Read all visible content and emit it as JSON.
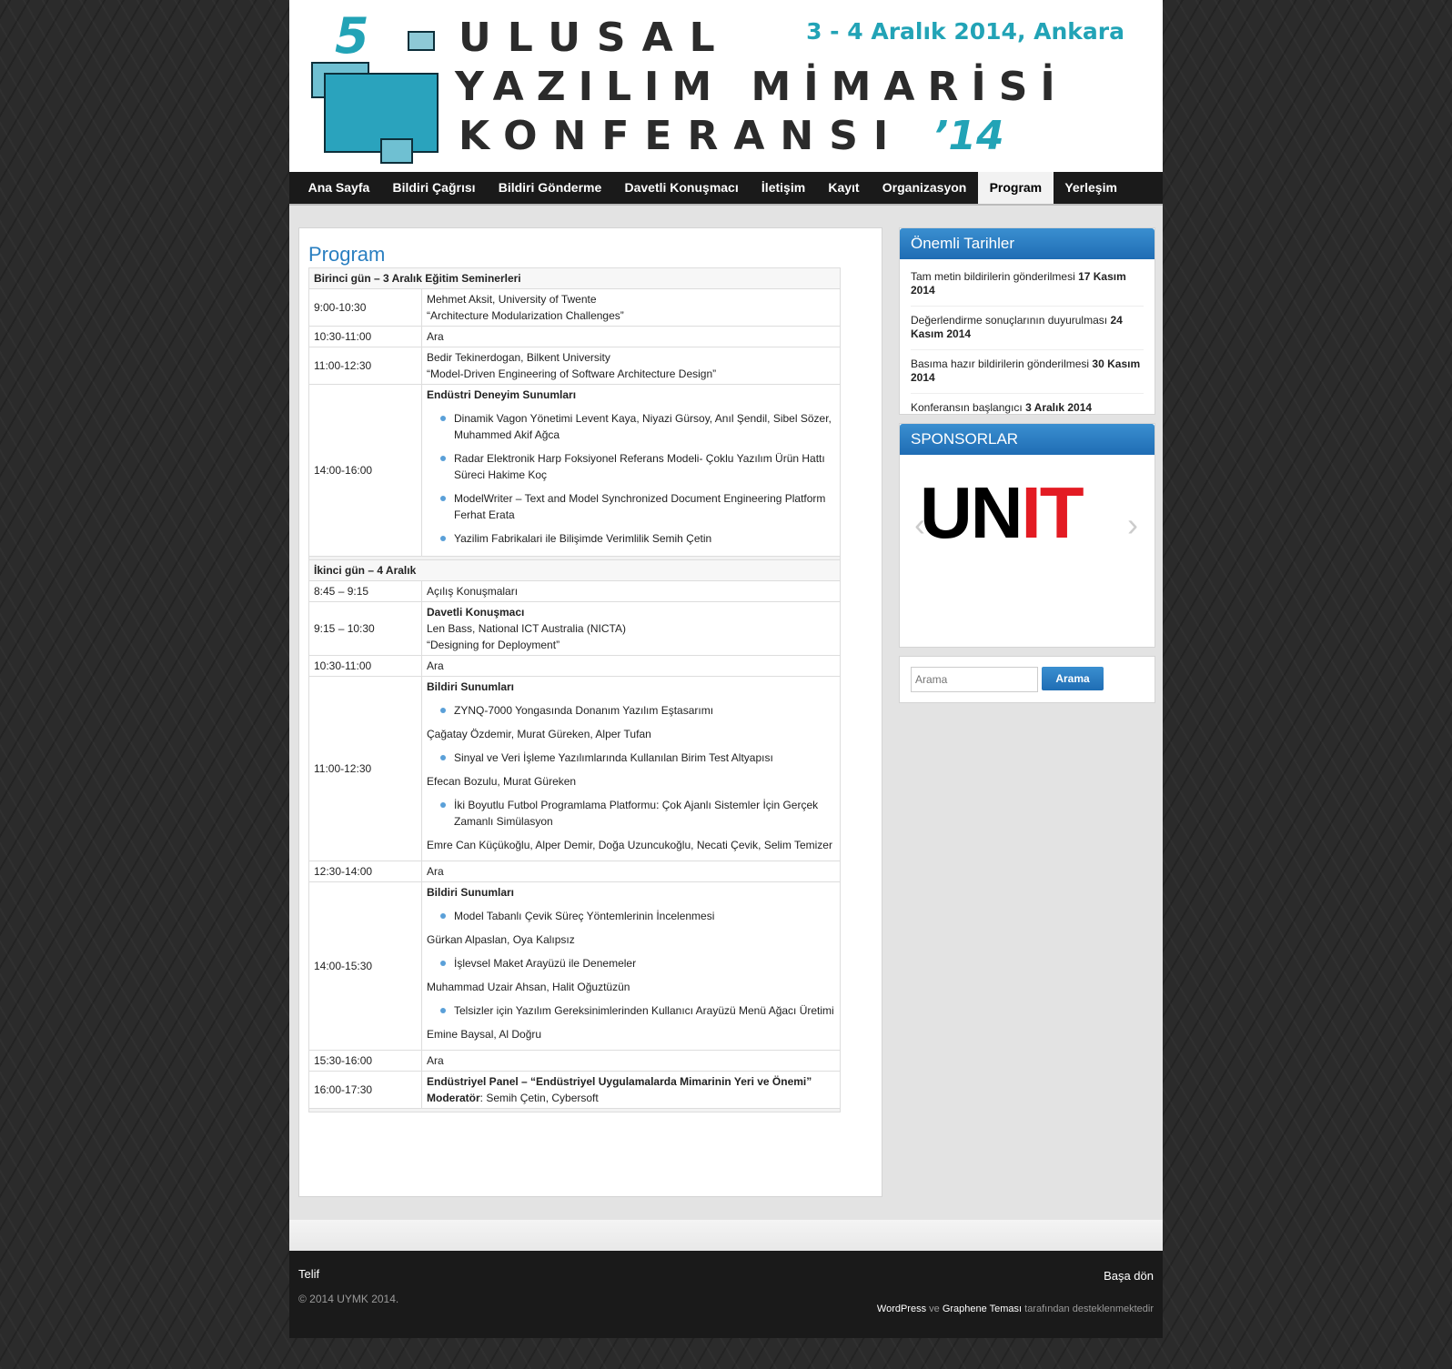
{
  "header": {
    "number": "5",
    "line1": "ULUSAL",
    "line2": "YAZILIM MİMARİSİ",
    "line3": "KONFERANSI",
    "year": "’14",
    "date": "3 - 4 Aralık 2014, Ankara"
  },
  "menu": [
    "Ana Sayfa",
    "Bildiri Çağrısı",
    "Bildiri Gönderme",
    "Davetli Konuşmacı",
    "İletişim",
    "Kayıt",
    "Organizasyon",
    "Program",
    "Yerleşim"
  ],
  "page": {
    "title": "Program"
  },
  "program": {
    "day1": "Birinci gün – 3 Aralık Eğitim Seminerleri",
    "r1_time": "9:00-10:30",
    "r1_l1": "Mehmet Aksit, University of Twente",
    "r1_l2": "“Architecture Modularization Challenges”",
    "r2_time": "10:30-11:00",
    "r2_text": "Ara",
    "r3_time": "11:00-12:30",
    "r3_l1": "Bedir Tekinerdogan, Bilkent University",
    "r3_l2": "“Model-Driven Engineering of Software Architecture Design”",
    "r4_time": "14:00-16:00",
    "r4_title": "Endüstri Deneyim Sunumları",
    "r4_items": [
      "Dinamik Vagon Yönetimi Levent Kaya, Niyazi Gürsoy, Anıl Şendil, Sibel Sözer, Muhammed Akif Ağca",
      "Radar Elektronik Harp Foksiyonel Referans Modeli- Çoklu Yazılım Ürün Hattı Süreci Hakime Koç",
      "ModelWriter – Text and Model Synchronized Document Engineering Platform Ferhat Erata",
      "Yazilim Fabrikalari ile Bilişimde Verimlilik Semih Çetin"
    ],
    "day2": "İkinci gün – 4 Aralık",
    "s1_time": "8:45 – 9:15",
    "s1_text": "Açılış Konuşmaları",
    "s2_time": "9:15 – 10:30",
    "s2_title": "Davetli Konuşmacı",
    "s2_l1": "Len Bass, National ICT Australia (NICTA)",
    "s2_l2": "“Designing for Deployment”",
    "s3_time": "10:30-11:00",
    "s3_text": "Ara",
    "s4_time": "11:00-12:30",
    "s4_title": "Bildiri Sunumları",
    "s4_p1": "ZYNQ-7000 Yongasında Donanım Yazılım Eştasarımı",
    "s4_a1": "Çağatay Özdemir, Murat Güreken, Alper Tufan",
    "s4_p2": "Sinyal ve Veri İşleme Yazılımlarında Kullanılan Birim Test Altyapısı",
    "s4_a2": "Efecan Bozulu, Murat Güreken",
    "s4_p3": "İki Boyutlu Futbol Programlama Platformu: Çok Ajanlı Sistemler İçin Gerçek Zamanlı Simülasyon",
    "s4_a3": "Emre Can Küçükoğlu, Alper Demir, Doğa Uzuncukoğlu, Necati Çevik, Selim Temizer",
    "s5_time": "12:30-14:00",
    "s5_text": "Ara",
    "s6_time": "14:00-15:30",
    "s6_title": "Bildiri Sunumları",
    "s6_p1": "Model Tabanlı Çevik Süreç Yöntemlerinin İncelenmesi",
    "s6_a1": "Gürkan Alpaslan, Oya Kalıpsız",
    "s6_p2": "İşlevsel Maket Arayüzü ile Denemeler",
    "s6_a2": "Muhammad Uzair Ahsan, Halit Oğuztüzün",
    "s6_p3": "Telsizler için Yazılım Gereksinimlerinden Kullanıcı Arayüzü Menü Ağacı Üretimi",
    "s6_a3": "Emine Baysal, Al Doğru",
    "s7_time": "15:30-16:00",
    "s7_text": "Ara",
    "s8_time": "16:00-17:30",
    "s8_title": "Endüstriyel Panel –  “Endüstriyel Uygulamalarda Mimarinin Yeri ve Önemi”",
    "s8_mod_label": "Moderatör",
    "s8_mod": ": Semih Çetin, Cybersoft"
  },
  "sidebar": {
    "dates_title": "Önemli Tarihler",
    "dates": [
      {
        "label": "Tam metin bildirilerin gönderilmesi ",
        "date": "17 Kasım 2014"
      },
      {
        "label": "Değerlendirme sonuçlarının duyurulması ",
        "date": "24 Kasım 2014"
      },
      {
        "label": "Basıma hazır bildirilerin gönderilmesi ",
        "date": "30 Kasım 2014"
      },
      {
        "label": "Konferansın başlangıcı ",
        "date": "3 Aralık 2014"
      }
    ],
    "sponsors_title": "SPONSORLAR",
    "sponsor_logo_a": "UN",
    "sponsor_logo_b": "IT",
    "search_placeholder": "Arama",
    "search_button": "Arama"
  },
  "footer": {
    "title": "Telif",
    "copyright": "© 2014 UYMK 2014.",
    "back_to_top": "Başa dön",
    "wp": "WordPress",
    "and": " ve ",
    "theme": "Graphene Teması",
    "powered": " tarafından desteklenmektedir"
  },
  "colors": {
    "accent": "#2a7fc1",
    "brand": "#22a3b6",
    "sponsor_red": "#e31b23"
  }
}
